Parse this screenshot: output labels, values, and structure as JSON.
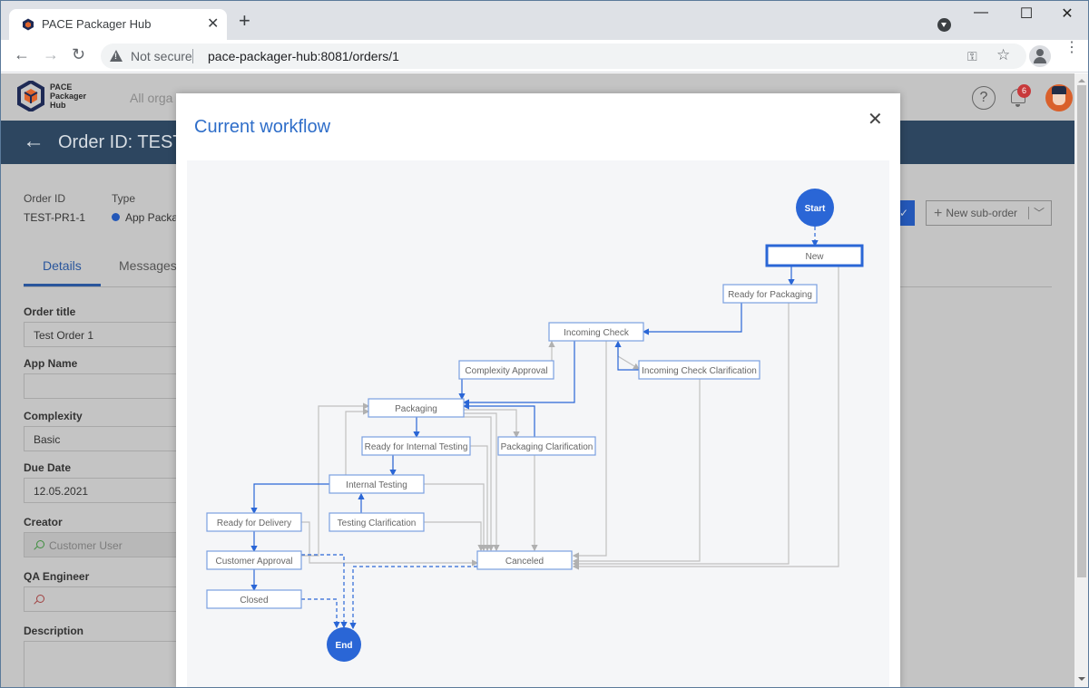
{
  "browser": {
    "tab_title": "PACE Packager Hub",
    "tab_close": "✕",
    "new_tab": "+",
    "window_controls": {
      "minimize": "—",
      "maximize": "☐",
      "close": "✕"
    },
    "nav": {
      "back": "←",
      "forward": "→",
      "reload": "↻"
    },
    "security_label": "Not secure",
    "url": "pace-packager-hub:8081/orders/1",
    "key_icon": "⚿",
    "star_icon": "☆",
    "menu_icon": "⋮"
  },
  "app": {
    "logo_lines": [
      "PACE",
      "Packager",
      "Hub"
    ],
    "org_selector": "All orga",
    "help_icon": "?",
    "notification_count": "6",
    "page_title": "Order ID: TEST",
    "back_icon": "←",
    "meta": {
      "order_id_label": "Order ID",
      "order_id_value": "TEST-PR1-1",
      "type_label": "Type",
      "type_value": "App Packa"
    },
    "tabs": [
      {
        "label": "Details",
        "active": true
      },
      {
        "label": "Messages",
        "active": false
      }
    ],
    "fields": [
      {
        "label": "Order title",
        "value": "Test Order 1"
      },
      {
        "label": "App Name",
        "value": ""
      },
      {
        "label": "Complexity",
        "value": "Basic"
      },
      {
        "label": "Due Date",
        "value": "12.05.2021"
      },
      {
        "label": "Creator",
        "value": "Customer User"
      },
      {
        "label": "QA Engineer",
        "value": ""
      },
      {
        "label": "Description",
        "value": ""
      }
    ],
    "action_check": "✓",
    "new_suborder_label": "New sub-order",
    "new_suborder_plus": "+",
    "new_suborder_chevron": "﹀"
  },
  "modal": {
    "title": "Current workflow",
    "close_icon": "✕"
  },
  "workflow": {
    "colors": {
      "active": "#2a66d6",
      "node_border": "#7a9fe0",
      "inactive_edge": "#c0c0c0",
      "text": "#666666"
    },
    "current_state": "New",
    "terminals": [
      {
        "id": "start",
        "label": "Start"
      },
      {
        "id": "end",
        "label": "End"
      }
    ],
    "states": [
      {
        "id": "new",
        "label": "New"
      },
      {
        "id": "rfp",
        "label": "Ready for Packaging"
      },
      {
        "id": "ic",
        "label": "Incoming Check"
      },
      {
        "id": "ca",
        "label": "Complexity Approval"
      },
      {
        "id": "icc",
        "label": "Incoming Check Clarification"
      },
      {
        "id": "pkg",
        "label": "Packaging"
      },
      {
        "id": "rfit",
        "label": "Ready for Internal Testing"
      },
      {
        "id": "pc",
        "label": "Packaging Clarification"
      },
      {
        "id": "it",
        "label": "Internal Testing"
      },
      {
        "id": "rfd",
        "label": "Ready for Delivery"
      },
      {
        "id": "tc",
        "label": "Testing Clarification"
      },
      {
        "id": "cust",
        "label": "Customer Approval"
      },
      {
        "id": "canc",
        "label": "Canceled"
      },
      {
        "id": "closed",
        "label": "Closed"
      }
    ]
  }
}
